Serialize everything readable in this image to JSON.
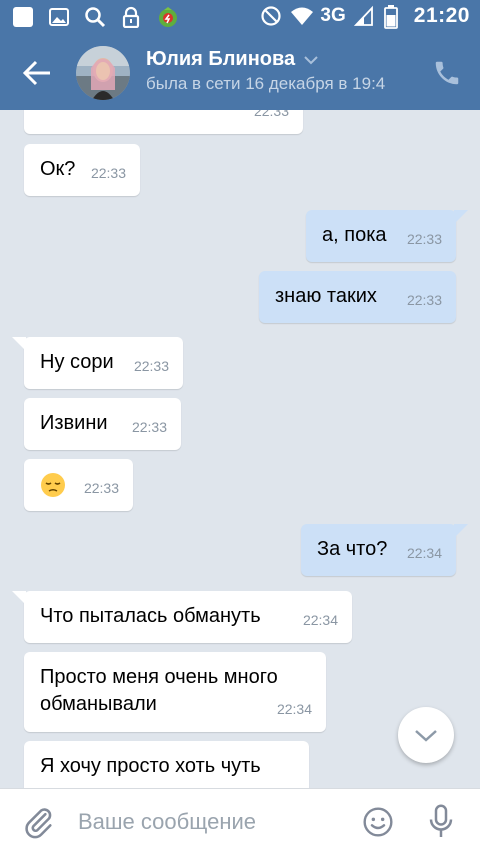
{
  "status_bar": {
    "network": "3G",
    "time": "21:20"
  },
  "header": {
    "name": "Юлия Блинова",
    "status": "была в сети 16 декабря в 19:4"
  },
  "messages": [
    {
      "dir": "in",
      "text": "",
      "time": "22:33"
    },
    {
      "dir": "in",
      "text": "Ок?",
      "time": "22:33"
    },
    {
      "dir": "out",
      "text": "а, пока",
      "time": "22:33"
    },
    {
      "dir": "out",
      "text": "знаю таких",
      "time": "22:33"
    },
    {
      "dir": "in",
      "text": "Ну сори",
      "time": "22:33"
    },
    {
      "dir": "in",
      "text": "Извини",
      "time": "22:33"
    },
    {
      "dir": "in",
      "text": "",
      "emoji": "pensive-face-icon",
      "time": "22:33"
    },
    {
      "dir": "out",
      "text": "За что?",
      "time": "22:34"
    },
    {
      "dir": "in",
      "text": "Что пыталась обмануть",
      "time": "22:34"
    },
    {
      "dir": "in",
      "text": "Просто меня очень много обманывали",
      "time": "22:34"
    },
    {
      "dir": "in",
      "text": "Я хочу просто хоть чуть",
      "time": ""
    }
  ],
  "composer": {
    "placeholder": "Ваше сообщение"
  },
  "colors": {
    "header": "#4a76a8",
    "background": "#dfe5ec",
    "outgoing_bubble": "#cce0f7",
    "incoming_bubble": "#ffffff"
  }
}
